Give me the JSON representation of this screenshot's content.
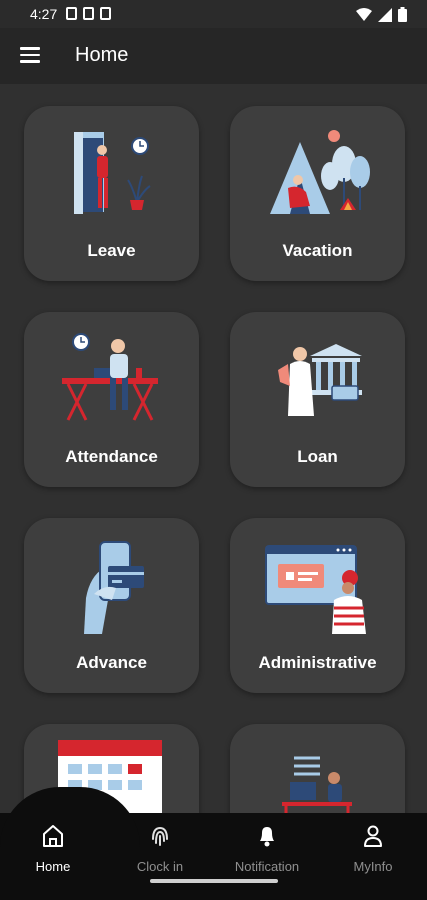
{
  "status_bar": {
    "time": "4:27"
  },
  "app_bar": {
    "title": "Home"
  },
  "cards": [
    {
      "label": "Leave"
    },
    {
      "label": "Vacation"
    },
    {
      "label": "Attendance"
    },
    {
      "label": "Loan"
    },
    {
      "label": "Advance"
    },
    {
      "label": "Administrative"
    },
    {
      "label": ""
    },
    {
      "label": ""
    }
  ],
  "bottom_nav": [
    {
      "label": "Home",
      "icon": "home-icon",
      "active": true
    },
    {
      "label": "Clock in",
      "icon": "fingerprint-icon"
    },
    {
      "label": "Notification",
      "icon": "bell-icon"
    },
    {
      "label": "MyInfo",
      "icon": "person-icon"
    }
  ],
  "colors": {
    "background": "#303030",
    "card": "#3e3e3e",
    "accent_red": "#d5262e",
    "accent_blue": "#a9cce8",
    "nav_bg": "#0d0d0d"
  }
}
